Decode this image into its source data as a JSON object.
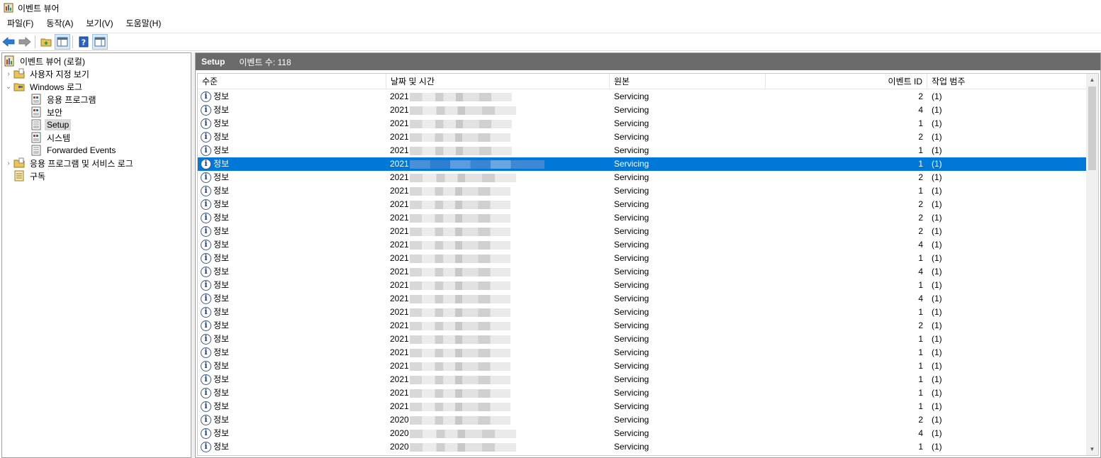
{
  "window": {
    "title": "이벤트 뷰어"
  },
  "menu": [
    {
      "label": "파일(F)"
    },
    {
      "label": "동작(A)"
    },
    {
      "label": "보기(V)"
    },
    {
      "label": "도움말(H)"
    }
  ],
  "tree": {
    "root": "이벤트 뷰어 (로컬)",
    "custom_views": "사용자 지정 보기",
    "windows_logs": "Windows 로그",
    "application": "응용 프로그램",
    "security": "보안",
    "setup": "Setup",
    "system": "시스템",
    "forwarded": "Forwarded Events",
    "app_services": "응용 프로그램 및 서비스 로그",
    "subscriptions": "구독"
  },
  "panel": {
    "title": "Setup",
    "count_label": "이벤트 수: 118"
  },
  "columns": {
    "level": "수준",
    "datetime": "날짜 및 시간",
    "source": "원본",
    "event_id": "이벤트 ID",
    "category": "작업 범주"
  },
  "rows": [
    {
      "level": "정보",
      "date": "2021",
      "source": "Servicing",
      "id": "2",
      "category": "(1)"
    },
    {
      "level": "정보",
      "date": "2021",
      "source": "Servicing",
      "id": "4",
      "category": "(1)"
    },
    {
      "level": "정보",
      "date": "2021",
      "source": "Servicing",
      "id": "1",
      "category": "(1)"
    },
    {
      "level": "정보",
      "date": "2021",
      "source": "Servicing",
      "id": "2",
      "category": "(1)"
    },
    {
      "level": "정보",
      "date": "2021",
      "source": "Servicing",
      "id": "1",
      "category": "(1)"
    },
    {
      "level": "정보",
      "date": "2021",
      "source": "Servicing",
      "id": "1",
      "category": "(1)"
    },
    {
      "level": "정보",
      "date": "2021",
      "source": "Servicing",
      "id": "2",
      "category": "(1)"
    },
    {
      "level": "정보",
      "date": "2021",
      "source": "Servicing",
      "id": "1",
      "category": "(1)"
    },
    {
      "level": "정보",
      "date": "2021",
      "source": "Servicing",
      "id": "2",
      "category": "(1)"
    },
    {
      "level": "정보",
      "date": "2021",
      "source": "Servicing",
      "id": "2",
      "category": "(1)"
    },
    {
      "level": "정보",
      "date": "2021",
      "source": "Servicing",
      "id": "2",
      "category": "(1)"
    },
    {
      "level": "정보",
      "date": "2021",
      "source": "Servicing",
      "id": "4",
      "category": "(1)"
    },
    {
      "level": "정보",
      "date": "2021",
      "source": "Servicing",
      "id": "1",
      "category": "(1)"
    },
    {
      "level": "정보",
      "date": "2021",
      "source": "Servicing",
      "id": "4",
      "category": "(1)"
    },
    {
      "level": "정보",
      "date": "2021",
      "source": "Servicing",
      "id": "1",
      "category": "(1)"
    },
    {
      "level": "정보",
      "date": "2021",
      "source": "Servicing",
      "id": "4",
      "category": "(1)"
    },
    {
      "level": "정보",
      "date": "2021",
      "source": "Servicing",
      "id": "1",
      "category": "(1)"
    },
    {
      "level": "정보",
      "date": "2021",
      "source": "Servicing",
      "id": "2",
      "category": "(1)"
    },
    {
      "level": "정보",
      "date": "2021",
      "source": "Servicing",
      "id": "1",
      "category": "(1)"
    },
    {
      "level": "정보",
      "date": "2021",
      "source": "Servicing",
      "id": "1",
      "category": "(1)"
    },
    {
      "level": "정보",
      "date": "2021",
      "source": "Servicing",
      "id": "1",
      "category": "(1)"
    },
    {
      "level": "정보",
      "date": "2021",
      "source": "Servicing",
      "id": "1",
      "category": "(1)"
    },
    {
      "level": "정보",
      "date": "2021",
      "source": "Servicing",
      "id": "1",
      "category": "(1)"
    },
    {
      "level": "정보",
      "date": "2021",
      "source": "Servicing",
      "id": "1",
      "category": "(1)"
    },
    {
      "level": "정보",
      "date": "2020",
      "source": "Servicing",
      "id": "2",
      "category": "(1)"
    },
    {
      "level": "정보",
      "date": "2020",
      "source": "Servicing",
      "id": "4",
      "category": "(1)"
    },
    {
      "level": "정보",
      "date": "2020",
      "source": "Servicing",
      "id": "1",
      "category": "(1)"
    }
  ],
  "selected_row": 5,
  "colors": {
    "selection": "#0078d7",
    "panel_header": "#6b6b6b"
  }
}
